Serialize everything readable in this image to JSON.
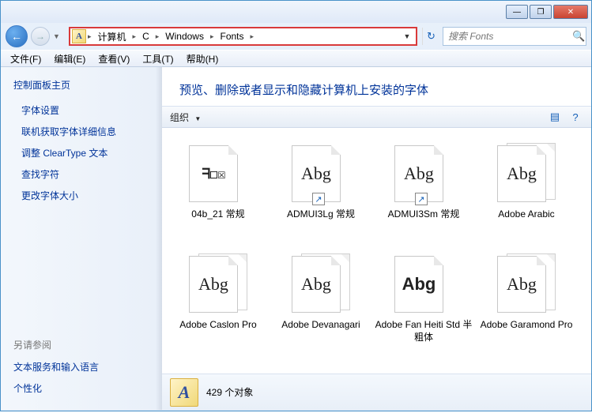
{
  "titlebar": {
    "min": "—",
    "max": "❐",
    "close": "✕"
  },
  "nav": {
    "back": "←",
    "fwd": "→",
    "dd": "▼",
    "refresh": "↻"
  },
  "breadcrumb": {
    "sep": "▸",
    "items": [
      "计算机",
      "C",
      "Windows",
      "Fonts"
    ]
  },
  "search": {
    "placeholder": "搜索 Fonts",
    "icon": "🔍"
  },
  "menu": {
    "items": [
      {
        "label": "文件(F)"
      },
      {
        "label": "编辑(E)"
      },
      {
        "label": "查看(V)"
      },
      {
        "label": "工具(T)"
      },
      {
        "label": "帮助(H)"
      }
    ]
  },
  "sidebar": {
    "title": "控制面板主页",
    "links": [
      "字体设置",
      "联机获取字体详细信息",
      "调整 ClearType 文本",
      "查找字符",
      "更改字体大小"
    ],
    "also_label": "另请参阅",
    "also_links": [
      "文本服务和输入语言",
      "个性化"
    ]
  },
  "main": {
    "heading": "预览、删除或者显示和隐藏计算机上安装的字体",
    "toolbar": {
      "organize": "组织",
      "dd": "▼",
      "view_icon": "▤",
      "help_icon": "?"
    },
    "fonts": [
      {
        "sample": "ᖷ◻☒",
        "label": "04b_21 常规",
        "style": "pix",
        "shortcut": false,
        "stack": false
      },
      {
        "sample": "Abg",
        "label": "ADMUI3Lg 常规",
        "style": "",
        "shortcut": true,
        "stack": false
      },
      {
        "sample": "Abg",
        "label": "ADMUI3Sm 常规",
        "style": "",
        "shortcut": true,
        "stack": false
      },
      {
        "sample": "Abg",
        "label": "Adobe Arabic",
        "style": "",
        "shortcut": false,
        "stack": true
      },
      {
        "sample": "Abg",
        "label": "Adobe Caslon Pro",
        "style": "",
        "shortcut": false,
        "stack": true
      },
      {
        "sample": "Abg",
        "label": "Adobe Devanagari",
        "style": "",
        "shortcut": false,
        "stack": true
      },
      {
        "sample": "Abg",
        "label": "Adobe Fan Heiti Std 半粗体",
        "style": "bold",
        "shortcut": false,
        "stack": false
      },
      {
        "sample": "Abg",
        "label": "Adobe Garamond Pro",
        "style": "",
        "shortcut": false,
        "stack": true
      }
    ]
  },
  "status": {
    "icon": "A",
    "text": "429 个对象"
  }
}
